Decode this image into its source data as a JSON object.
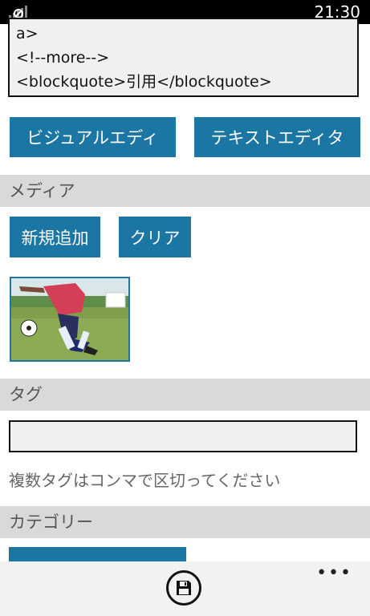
{
  "status_bar": {
    "time": "21:30",
    "signal_icon": "no-signal-icon"
  },
  "editor": {
    "lines": [
      "a>",
      "<!--more-->",
      "<blockquote>引用</blockquote>"
    ]
  },
  "editor_modes": {
    "visual_label": "ビジュアルエディ",
    "text_label": "テキストエディタ"
  },
  "media": {
    "header": "メディア",
    "add_label": "新規追加",
    "clear_label": "クリア",
    "thumbnail_icon": "soccer-photo"
  },
  "tags": {
    "header": "タグ",
    "value": "",
    "hint": "複数タグはコンマで区切ってください"
  },
  "category": {
    "header": "カテゴリー"
  },
  "app_bar": {
    "save_icon": "save-icon",
    "more_label": "•••"
  },
  "colors": {
    "accent": "#1b76a3",
    "section_bg": "#d9d9d9",
    "field_bg": "#f0f0f0"
  }
}
